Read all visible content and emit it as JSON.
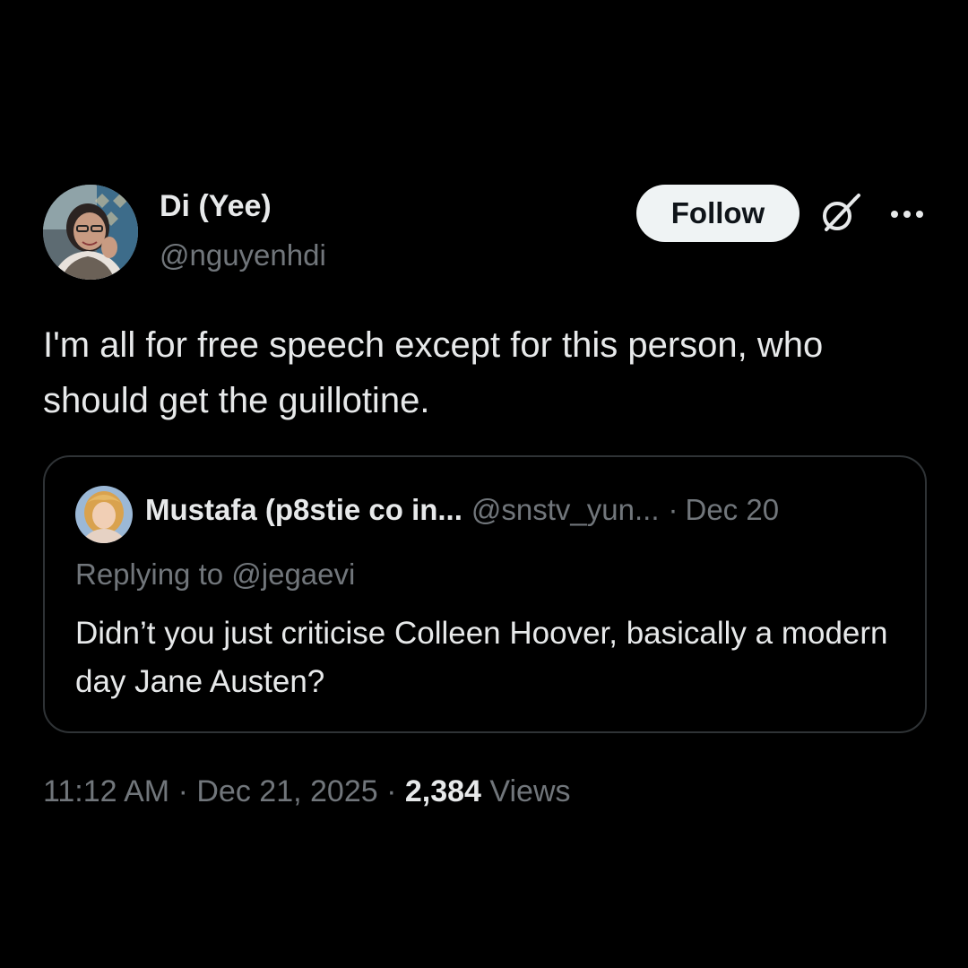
{
  "author": {
    "display_name": "Di (Yee)",
    "handle": "@nguyenhdi"
  },
  "actions": {
    "follow_label": "Follow",
    "grok_icon": "grok-icon",
    "more_icon": "more-options-icon"
  },
  "tweet": {
    "text": "I'm all for free speech except for this person, who should get the guillotine."
  },
  "quoted_tweet": {
    "display_name": "Mustafa (p8stie co in...",
    "handle": "@snstv_yun...",
    "separator": "·",
    "date": "Dec 20",
    "replying_to": "Replying to @jegaevi",
    "text": "Didn’t you just criticise Colleen Hoover, basically a modern day Jane Austen?"
  },
  "meta": {
    "time": "11:12 AM",
    "sep1": "·",
    "date": "Dec 21, 2025",
    "sep2": "·",
    "views_count": "2,384",
    "views_label": "Views"
  },
  "colors": {
    "background": "#000000",
    "primary_text": "#e7e9ea",
    "secondary_text": "#71767b",
    "border": "#2f3336",
    "follow_bg": "#eff3f4"
  }
}
